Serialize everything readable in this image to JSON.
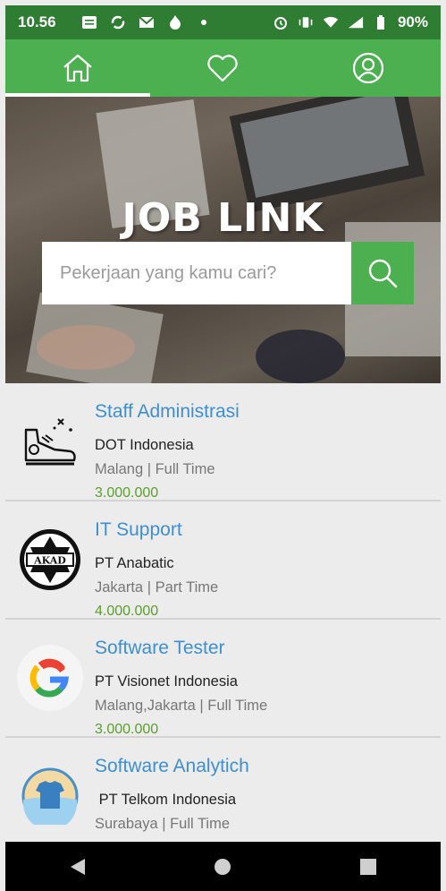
{
  "status_bar": {
    "time": "10.56",
    "battery": "90%"
  },
  "tabs": [
    {
      "icon": "home-icon"
    },
    {
      "icon": "heart-icon"
    },
    {
      "icon": "profile-icon"
    }
  ],
  "hero": {
    "title": "JOB LINK"
  },
  "search": {
    "placeholder": "Pekerjaan yang kamu cari?"
  },
  "jobs": [
    {
      "title": "Staff Administrasi",
      "company": "DOT Indonesia",
      "meta": "Malang | Full Time",
      "salary": "3.000.000",
      "logo": "sneaker-icon"
    },
    {
      "title": "IT Support",
      "company": "PT Anabatic",
      "meta": "Jakarta | Part Time",
      "salary": "4.000.000",
      "logo": "akad-logo"
    },
    {
      "title": "Software Tester",
      "company": "PT Visionet Indonesia",
      "meta": "Malang,Jakarta | Full Time",
      "salary": "3.000.000",
      "logo": "google-logo"
    },
    {
      "title": "Software Analytich",
      "company": " PT Telkom Indonesia",
      "meta": "Surabaya | Full Time",
      "salary": "",
      "logo": "shirt-logo"
    }
  ],
  "colors": {
    "primary": "#4caf50",
    "status": "#2f7d32",
    "title": "#3f8fd0",
    "salary": "#5a9e2c"
  }
}
